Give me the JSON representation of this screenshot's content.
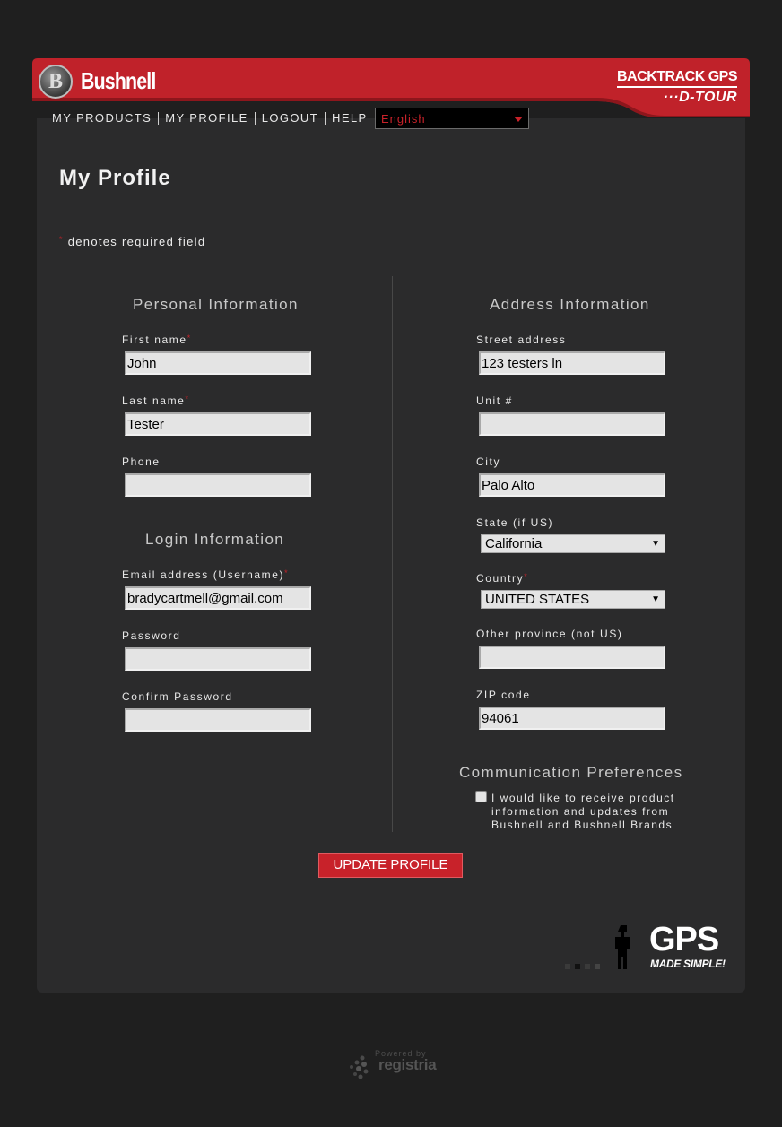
{
  "header": {
    "logo_text": "Bushnell",
    "logo_badge": "B",
    "brand_line1": "BACKTRACK GPS",
    "brand_line2": "···D-TOUR",
    "banner_color": "#c0222a"
  },
  "nav": {
    "items": [
      "MY PRODUCTS",
      "MY PROFILE",
      "LOGOUT",
      "HELP"
    ],
    "language": "English"
  },
  "page": {
    "title": "My Profile",
    "required_note": "denotes required field",
    "required_marker": "*"
  },
  "personal": {
    "title": "Personal Information",
    "first_name_label": "First name",
    "first_name_value": "John",
    "last_name_label": "Last name",
    "last_name_value": "Tester",
    "phone_label": "Phone",
    "phone_value": ""
  },
  "login": {
    "title": "Login Information",
    "email_label": "Email address (Username)",
    "email_value": "bradycartmell@gmail.com",
    "password_label": "Password",
    "confirm_label": "Confirm Password"
  },
  "address": {
    "title": "Address Information",
    "street_label": "Street address",
    "street_value": "123 testers ln",
    "unit_label": "Unit #",
    "unit_value": "",
    "city_label": "City",
    "city_value": "Palo Alto",
    "state_label": "State (if US)",
    "state_value": "California",
    "country_label": "Country",
    "country_value": "UNITED STATES",
    "province_label": "Other province (not US)",
    "province_value": "",
    "zip_label": "ZIP code",
    "zip_value": "94061"
  },
  "preferences": {
    "title": "Communication Preferences",
    "checkbox_text": "I would like to receive product information and updates from Bushnell and Bushnell Brands",
    "checked": false
  },
  "actions": {
    "update_label": "UPDATE PROFILE"
  },
  "footer": {
    "gps_word": "GPS",
    "gps_tagline": "MADE SIMPLE!",
    "powered_by": "Powered by",
    "powered_name": "registria"
  },
  "colors": {
    "accent": "#c8222a",
    "panel": "#2b2b2c",
    "background": "#1f1f1f"
  }
}
